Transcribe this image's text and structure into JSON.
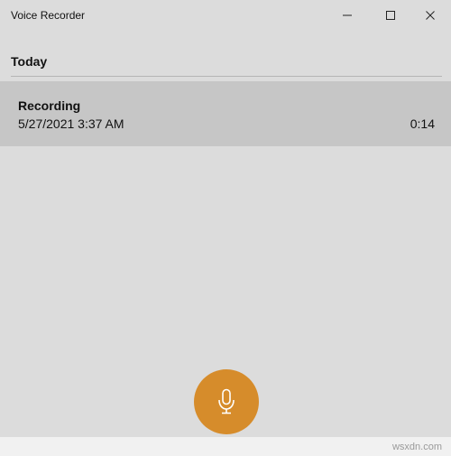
{
  "window": {
    "title": "Voice Recorder",
    "controls": {
      "minimize_icon": "minimize-icon",
      "maximize_icon": "maximize-icon",
      "close_icon": "close-icon"
    }
  },
  "list": {
    "section_header": "Today",
    "recordings": [
      {
        "name": "Recording",
        "date": "5/27/2021 3:37 AM",
        "duration": "0:14"
      }
    ]
  },
  "record_button": {
    "icon": "microphone-icon",
    "color": "#d68c2b"
  },
  "watermark": "wsxdn.com",
  "colors": {
    "background": "#dcdcdc",
    "selected_item": "#c6c6c6",
    "accent": "#d68c2b"
  }
}
